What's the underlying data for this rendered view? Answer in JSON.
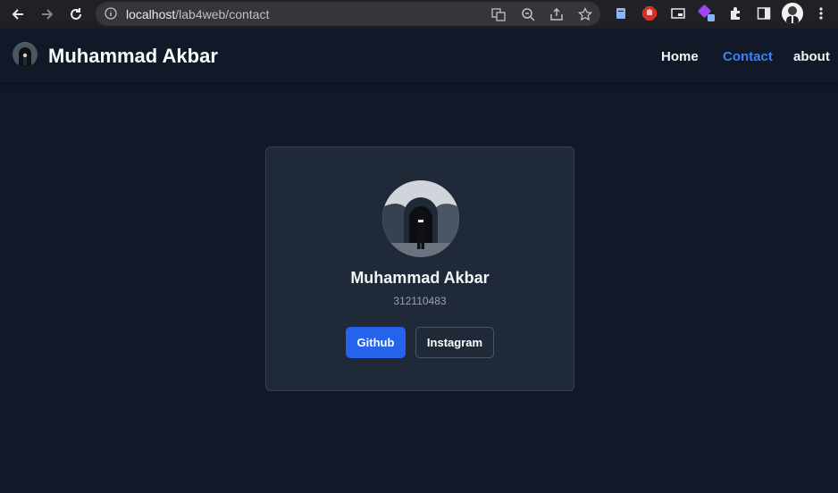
{
  "browser": {
    "url_host": "localhost",
    "url_path": "/lab4web/contact",
    "icons": [
      "back-arrow-icon",
      "forward-arrow-icon",
      "reload-icon",
      "info-icon",
      "translate-icon",
      "zoom-icon",
      "share-icon",
      "star-icon",
      "extension-icons",
      "puzzle-icon",
      "side-panel-icon",
      "profile-avatar",
      "more-vert-icon"
    ]
  },
  "site": {
    "brand_name": "Muhammad Akbar",
    "nav": {
      "home": "Home",
      "contact": "Contact",
      "about": "about"
    },
    "active_nav": "contact"
  },
  "card": {
    "name": "Muhammad Akbar",
    "id": "312110483",
    "buttons": {
      "github": "Github",
      "instagram": "Instagram"
    }
  },
  "colors": {
    "background": "#111827",
    "card": "#1f2937",
    "accent": "#3b82f6",
    "primary_button": "#2563eb"
  }
}
